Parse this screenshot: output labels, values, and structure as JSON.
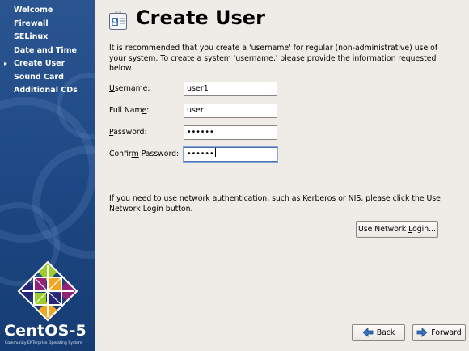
{
  "sidebar": {
    "items": [
      {
        "label": "Welcome",
        "active": false
      },
      {
        "label": "Firewall",
        "active": false
      },
      {
        "label": "SELinux",
        "active": false
      },
      {
        "label": "Date and Time",
        "active": false
      },
      {
        "label": "Create User",
        "active": true
      },
      {
        "label": "Sound Card",
        "active": false
      },
      {
        "label": "Additional CDs",
        "active": false
      }
    ],
    "logo_text": "CentOS-5",
    "logo_tagline": "Community ENTerprise Operating System"
  },
  "page": {
    "title": "Create User",
    "intro": "It is recommended that you create a 'username' for regular (non-administrative) use of your system. To create a system 'username,' please provide the information requested below."
  },
  "form": {
    "username_label_pre": "",
    "username_label_mn": "U",
    "username_label_post": "sername:",
    "username_value": "user1",
    "fullname_label_pre": "Full Nam",
    "fullname_label_mn": "e",
    "fullname_label_post": ":",
    "fullname_value": "user",
    "password_label_pre": "",
    "password_label_mn": "P",
    "password_label_post": "assword:",
    "password_value": "••••••",
    "confirm_label_pre": "Confir",
    "confirm_label_mn": "m",
    "confirm_label_post": " Password:",
    "confirm_value": "••••••"
  },
  "network": {
    "text": "If you need to use network authentication, such as Kerberos or NIS, please click the Use Network Login button.",
    "button_pre": "Use Network ",
    "button_mn": "L",
    "button_post": "ogin..."
  },
  "nav": {
    "back_mn": "B",
    "back_post": "ack",
    "forward_mn": "F",
    "forward_post": "orward"
  },
  "colors": {
    "sidebar_bg": "#1f4a86",
    "window_bg": "#efebe7",
    "focus_border": "#4a6fb0"
  }
}
